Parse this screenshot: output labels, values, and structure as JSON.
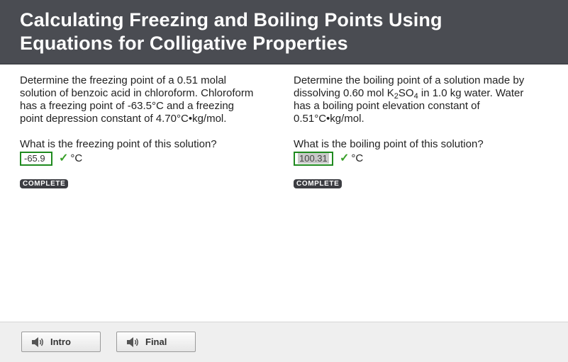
{
  "header": {
    "title_line1": "Calculating Freezing and Boiling Points Using",
    "title_line2": "Equations for Colligative Properties"
  },
  "questions": [
    {
      "text_lines": [
        "Determine the freezing point of a 0.51 molal",
        "solution of benzoic acid in chloroform. Chloroform",
        "has a freezing point of -63.5°C and a freezing",
        "point depression constant of 4.70°C•kg/mol."
      ],
      "prompt": "What is the freezing point of this solution?",
      "answer": "-65.9",
      "check": "✓",
      "unit": "°C",
      "status": "COMPLETE"
    },
    {
      "text_line1_a": "Determine the boiling point of a solution made by",
      "text_line2_a": "dissolving 0.60 mol K",
      "text_line2_sub1": "2",
      "text_line2_b": "SO",
      "text_line2_sub2": "4",
      "text_line2_c": " in 1.0 kg water. Water",
      "text_line3": "has a boiling point elevation constant of",
      "text_line4": "0.51°C•kg/mol.",
      "prompt": "What is the boiling point of this solution?",
      "answer": "100.31",
      "check": "✓",
      "unit": "°C",
      "status": "COMPLETE"
    }
  ],
  "footer": {
    "buttons": [
      {
        "label": "Intro",
        "icon": "speaker-icon"
      },
      {
        "label": "Final",
        "icon": "speaker-icon"
      }
    ]
  },
  "colors": {
    "header_bg": "#4a4c52",
    "correct_green": "#3aa02a",
    "badge_bg": "#3c3d42"
  }
}
